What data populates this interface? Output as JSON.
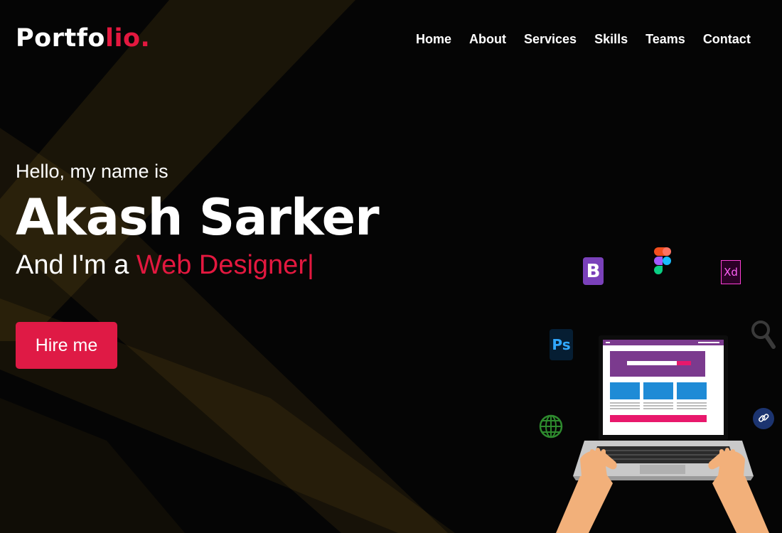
{
  "logo": {
    "main": "Portfo",
    "accent": "lio."
  },
  "nav": {
    "items": [
      {
        "label": "Home"
      },
      {
        "label": "About"
      },
      {
        "label": "Services"
      },
      {
        "label": "Skills"
      },
      {
        "label": "Teams"
      },
      {
        "label": "Contact"
      }
    ]
  },
  "hero": {
    "greeting": "Hello, my name is",
    "name": "Akash Sarker",
    "tagline_prefix": "And I'm a ",
    "tagline_role": "Web Designer",
    "cursor": "|",
    "cta_label": "Hire me"
  },
  "illustration": {
    "bootstrap_letter": "B",
    "xd_label": "Xd",
    "ps_label": "Ps",
    "icons": [
      "bootstrap-icon",
      "figma-icon",
      "xd-icon",
      "photoshop-icon",
      "globe-icon",
      "search-icon",
      "link-icon",
      "laptop-icon"
    ]
  },
  "colors": {
    "accent": "#e3183f",
    "button": "#df1a45",
    "background": "#050505",
    "ray": "#f5b82e"
  }
}
